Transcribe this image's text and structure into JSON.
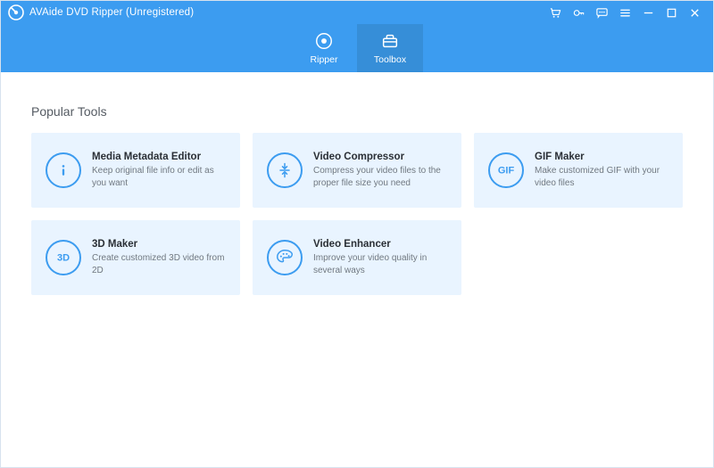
{
  "titlebar": {
    "app_title": "AVAide DVD Ripper (Unregistered)"
  },
  "nav": {
    "ripper_label": "Ripper",
    "toolbox_label": "Toolbox"
  },
  "section": {
    "heading": "Popular Tools"
  },
  "tools": {
    "metadata": {
      "title": "Media Metadata Editor",
      "desc": "Keep original file info or edit as you want"
    },
    "compressor": {
      "title": "Video Compressor",
      "desc": "Compress your video files to the proper file size you need"
    },
    "gif": {
      "title": "GIF Maker",
      "desc": "Make customized GIF with your video files"
    },
    "threeD": {
      "title": "3D Maker",
      "desc": "Create customized 3D video from 2D"
    },
    "enhancer": {
      "title": "Video Enhancer",
      "desc": "Improve your video quality in several ways"
    }
  },
  "colors": {
    "brand": "#3c9cf0",
    "brand_active": "#368ed8",
    "card_bg": "#e9f4ff"
  }
}
